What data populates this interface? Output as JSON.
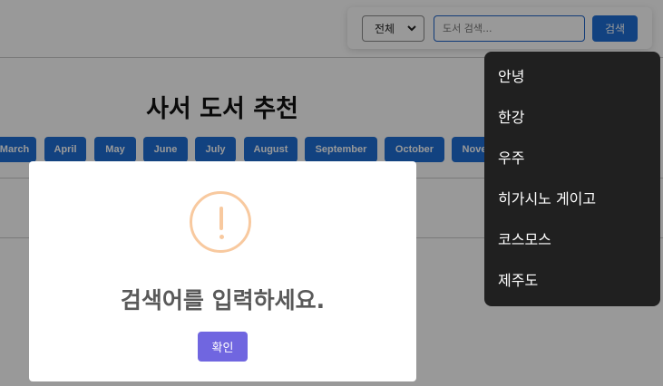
{
  "search": {
    "category_selected": "전체",
    "placeholder": "도서 검색...",
    "button_label": "검색"
  },
  "page": {
    "title": "사서 도서 추천"
  },
  "months": [
    "March",
    "April",
    "May",
    "June",
    "July",
    "August",
    "September",
    "October",
    "Nove"
  ],
  "suggestions": [
    "안녕",
    "한강",
    "우주",
    "히가시노 게이고",
    "코스모스",
    "제주도"
  ],
  "modal": {
    "icon": "warning-icon",
    "icon_text": "!",
    "message": "검색어를 입력하세요.",
    "confirm_label": "확인"
  },
  "colors": {
    "accent": "#1f6fd6",
    "confirm": "#7066e0",
    "warning": "#f8c99f",
    "menu_bg": "#202020"
  }
}
